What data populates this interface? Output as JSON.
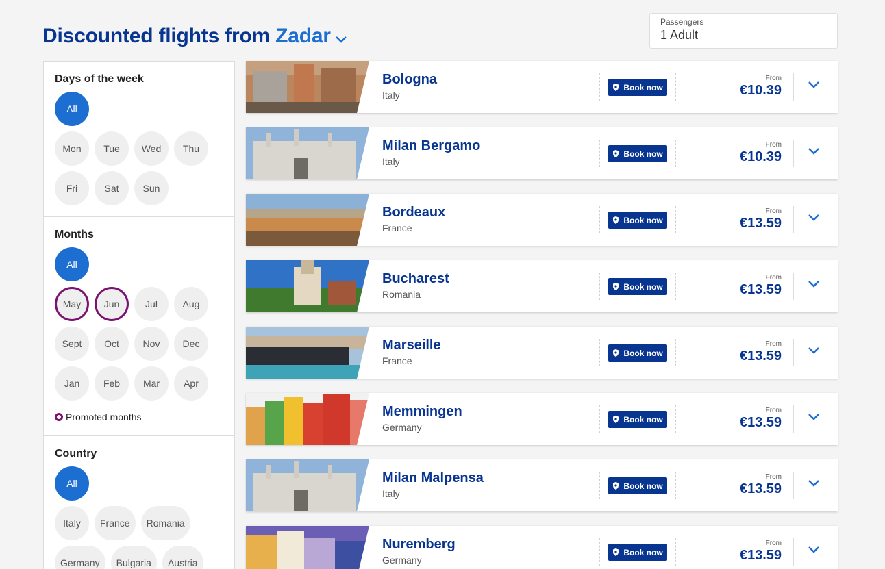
{
  "header": {
    "title_prefix": "Discounted flights from",
    "origin_city": "Zadar",
    "dropdown_icon": "chevron-down-icon"
  },
  "passengers": {
    "label": "Passengers",
    "value": "1 Adult"
  },
  "filters": {
    "days": {
      "title": "Days of the week",
      "options": [
        "All",
        "Mon",
        "Tue",
        "Wed",
        "Thu",
        "Fri",
        "Sat",
        "Sun"
      ],
      "selected": "All"
    },
    "months": {
      "title": "Months",
      "options": [
        "All",
        "May",
        "Jun",
        "Jul",
        "Aug",
        "Sept",
        "Oct",
        "Nov",
        "Dec",
        "Jan",
        "Feb",
        "Mar",
        "Apr"
      ],
      "selected": "All",
      "promoted": [
        "May",
        "Jun"
      ],
      "legend": "Promoted months"
    },
    "country": {
      "title": "Country",
      "options": [
        "All",
        "Italy",
        "France",
        "Romania",
        "Germany",
        "Bulgaria",
        "Austria"
      ],
      "selected": "All"
    }
  },
  "flights": [
    {
      "city": "Bologna",
      "country": "Italy",
      "book_label": "Book now",
      "from_label": "From",
      "price": "€10.39"
    },
    {
      "city": "Milan Bergamo",
      "country": "Italy",
      "book_label": "Book now",
      "from_label": "From",
      "price": "€10.39"
    },
    {
      "city": "Bordeaux",
      "country": "France",
      "book_label": "Book now",
      "from_label": "From",
      "price": "€13.59"
    },
    {
      "city": "Bucharest",
      "country": "Romania",
      "book_label": "Book now",
      "from_label": "From",
      "price": "€13.59"
    },
    {
      "city": "Marseille",
      "country": "France",
      "book_label": "Book now",
      "from_label": "From",
      "price": "€13.59"
    },
    {
      "city": "Memmingen",
      "country": "Germany",
      "book_label": "Book now",
      "from_label": "From",
      "price": "€13.59"
    },
    {
      "city": "Milan Malpensa",
      "country": "Italy",
      "book_label": "Book now",
      "from_label": "From",
      "price": "€13.59"
    },
    {
      "city": "Nuremberg",
      "country": "Germany",
      "book_label": "Book now",
      "from_label": "From",
      "price": "€13.59"
    }
  ],
  "colors": {
    "brand_navy": "#073590",
    "accent_blue": "#1c6fd1",
    "promoted_purple": "#7b1470",
    "background": "#f4f4f4"
  }
}
